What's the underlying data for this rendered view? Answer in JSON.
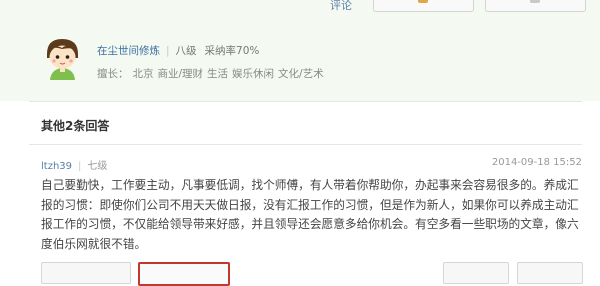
{
  "top_answer": {
    "comment_label": "评论",
    "answerer_name": "在尘世间修炼",
    "level": "八级",
    "adoption_rate": "采纳率70%",
    "expertise_label": "擅长：",
    "expertise_tags": [
      "北京",
      "商业/理财",
      "生活",
      "娱乐休闲",
      "文化/艺术"
    ]
  },
  "other_answers": {
    "title": "其他2条回答",
    "reply": {
      "user": "ltzh39",
      "level": "七级",
      "date": "2014-09-18 15:52",
      "text": "自己要勤快，工作要主动，凡事要低调，找个师傅，有人带着你帮助你，办起事来会容易很多的。养成汇报的习惯：即使你们公司不用天天做日报，没有汇报工作的习惯，但是作为新人，如果你可以养成主动汇报工作的习惯，不仅能给领导带来好感，并且领导还会愿意多给你机会。有空多看一些职场的文章，像六度伯乐网就很不错。"
    }
  },
  "colors": {
    "top_block_bg": "#f4faf1",
    "link": "#3b6ea5",
    "highlight_border": "#c0392b"
  },
  "icons": {
    "avatar": "cartoon-avatar-icon",
    "vote": "thumb-icon"
  }
}
